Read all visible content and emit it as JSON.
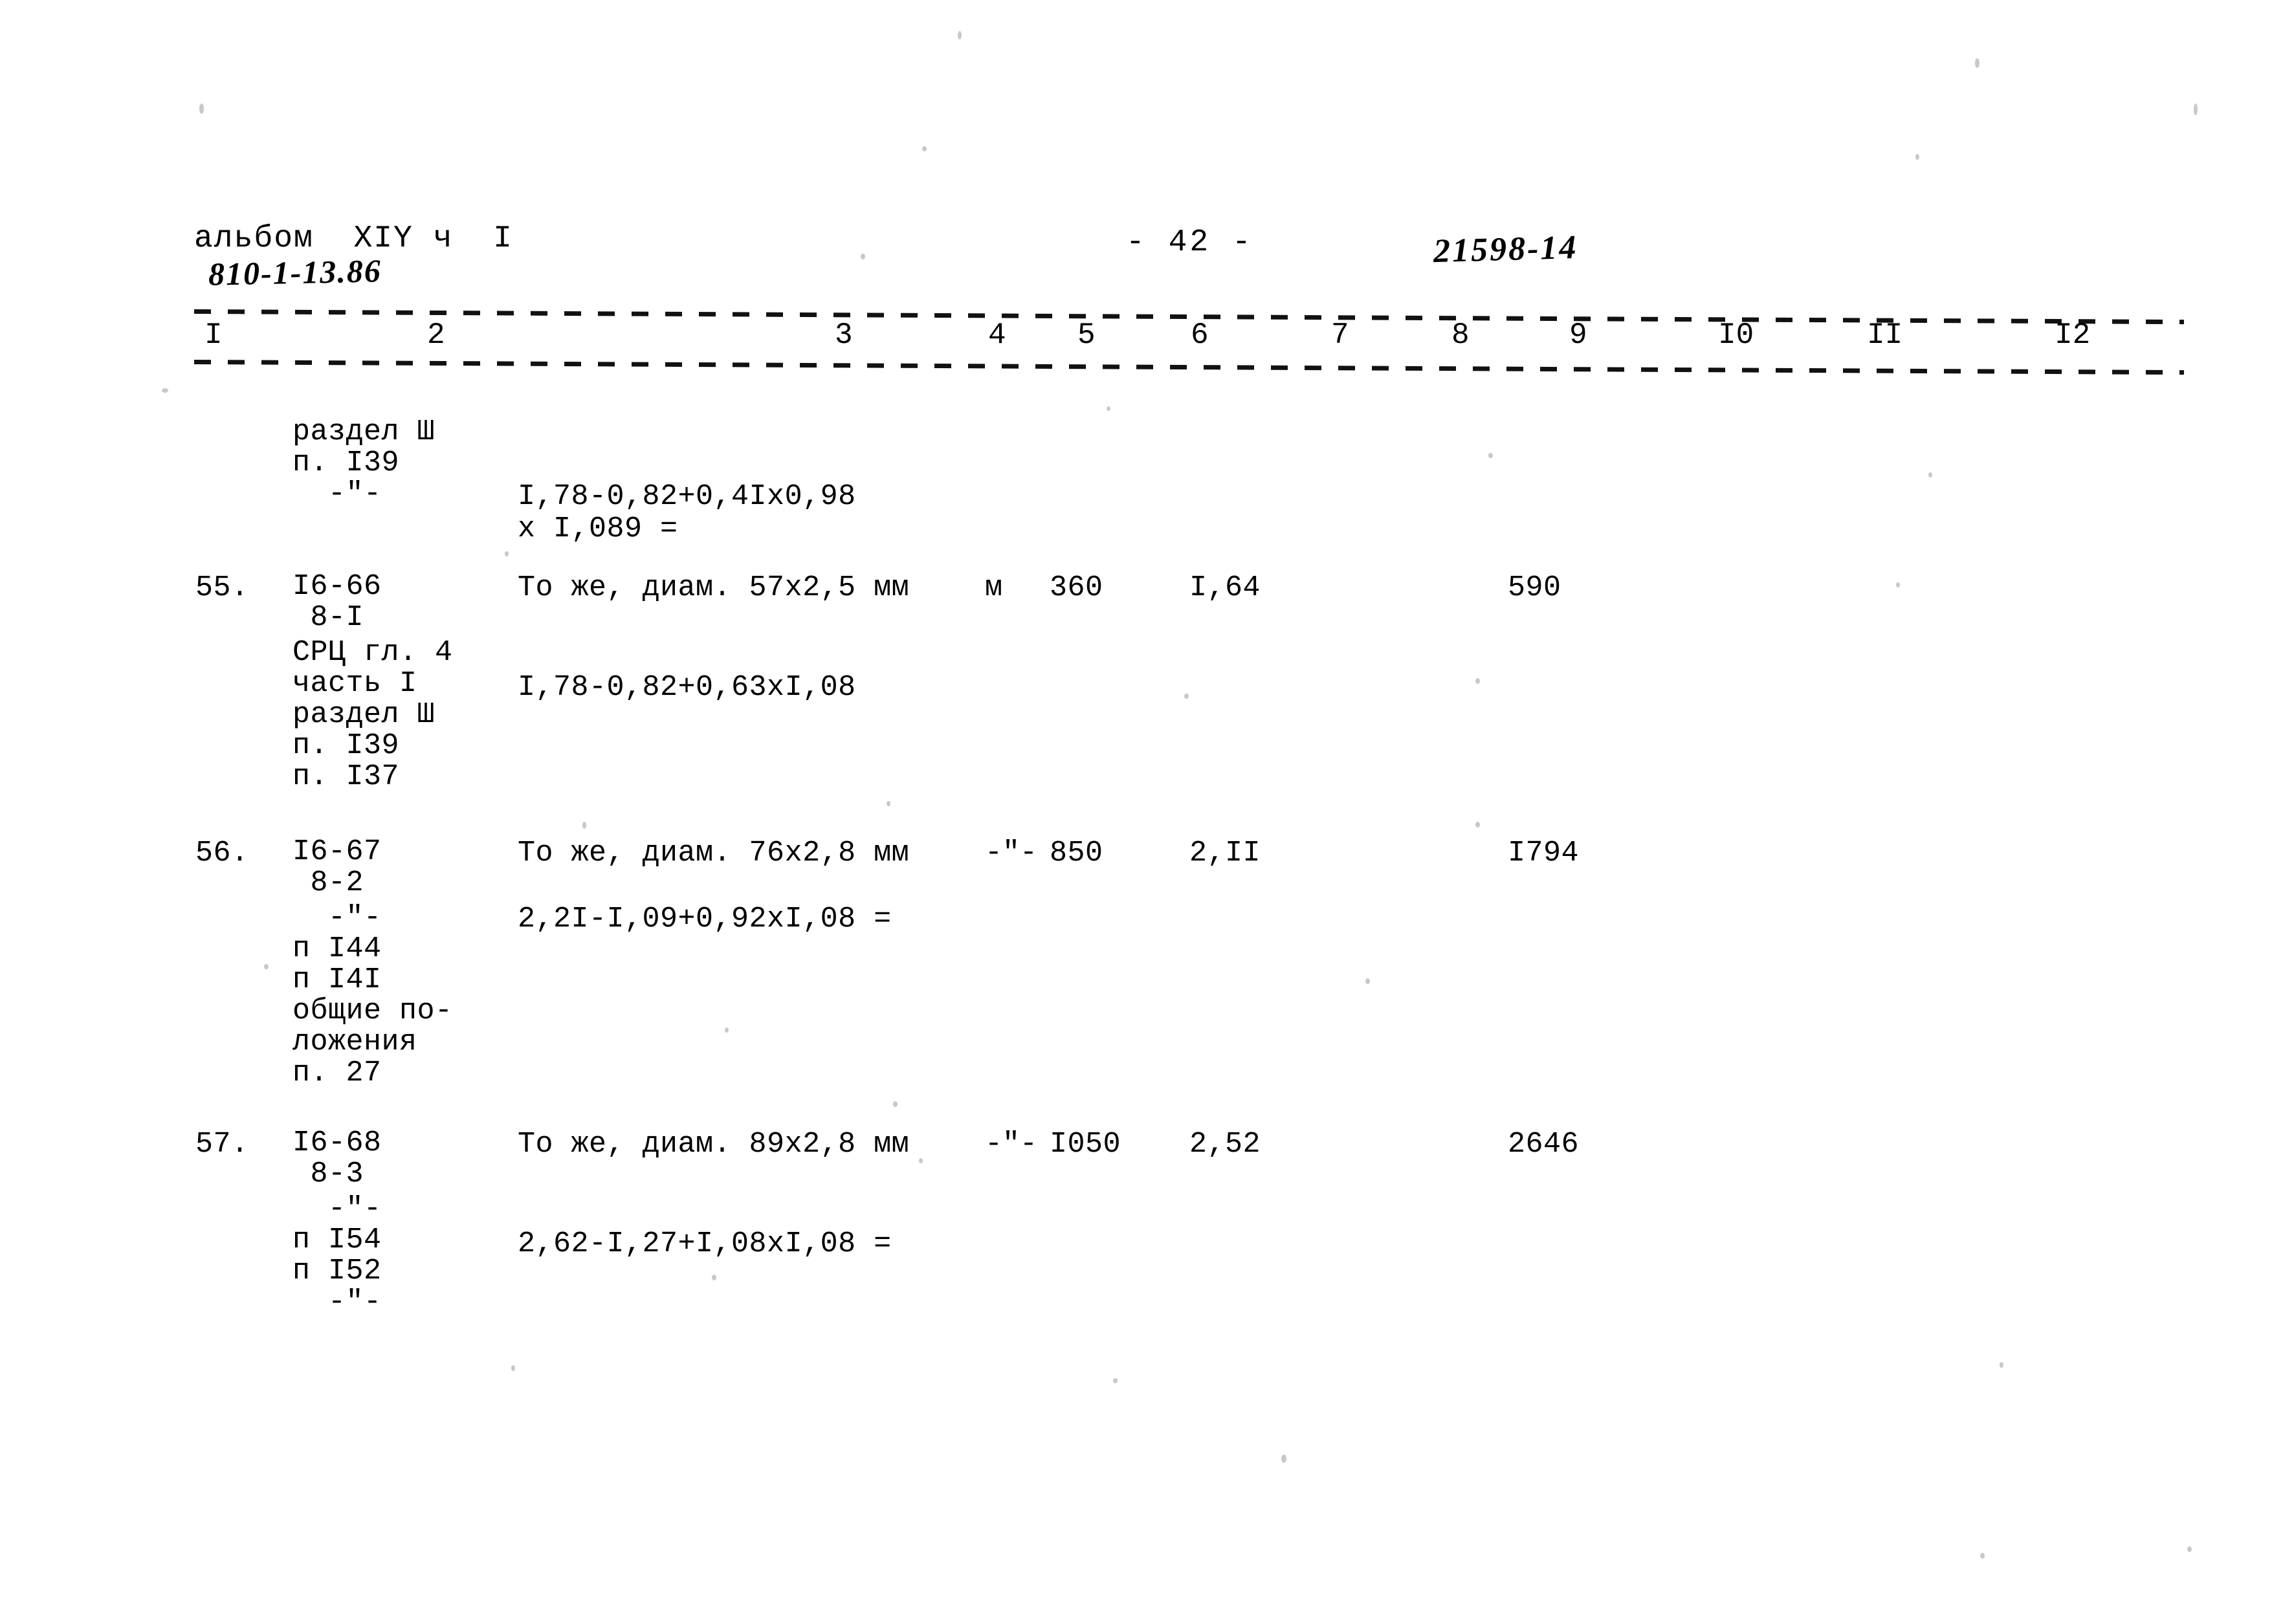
{
  "header": {
    "album": "альбом  XIY ч  I",
    "code": "810-1-13.86",
    "page_label": "- 42 -",
    "stamp": "21598-14"
  },
  "table": {
    "column_numbers": [
      "I",
      "2",
      "3",
      "4",
      "5",
      "6",
      "7",
      "8",
      "9",
      "I0",
      "II",
      "I2"
    ],
    "continuation_block": {
      "refs": "раздел Ш\nп. I39\n  -\"-",
      "formula_line1": "I,78-0,82+0,4Ix0,98",
      "formula_line2": "x I,089 ="
    },
    "rows": [
      {
        "number": "55.",
        "code": "I6-66\n 8-I",
        "description": "То же, диам. 57х2,5 мм",
        "unit": "м",
        "quantity": "360",
        "price": "I,64",
        "total": "590",
        "refs": "СРЦ гл. 4\nчасть I\nраздел Ш\nп. I39\nп. I37",
        "formula": "I,78-0,82+0,63хI,08"
      },
      {
        "number": "56.",
        "code": "I6-67\n 8-2",
        "description": "То же, диам. 76х2,8 мм",
        "unit": "-\"-",
        "quantity": "850",
        "price": "2,II",
        "total": "I794",
        "refs": "  -\"-\nп I44\nп I4I\nобщие по-\nложения\nп. 27",
        "formula": "2,2I-I,09+0,92хI,08 ="
      },
      {
        "number": "57.",
        "code": "I6-68\n 8-3",
        "description": "То же, диам. 89х2,8 мм",
        "unit": "-\"-",
        "quantity": "I050",
        "price": "2,52",
        "total": "2646",
        "refs": "  -\"-\nп I54\nп I52\n  -\"-",
        "formula": "2,62-I,27+I,08хI,08 ="
      }
    ]
  }
}
